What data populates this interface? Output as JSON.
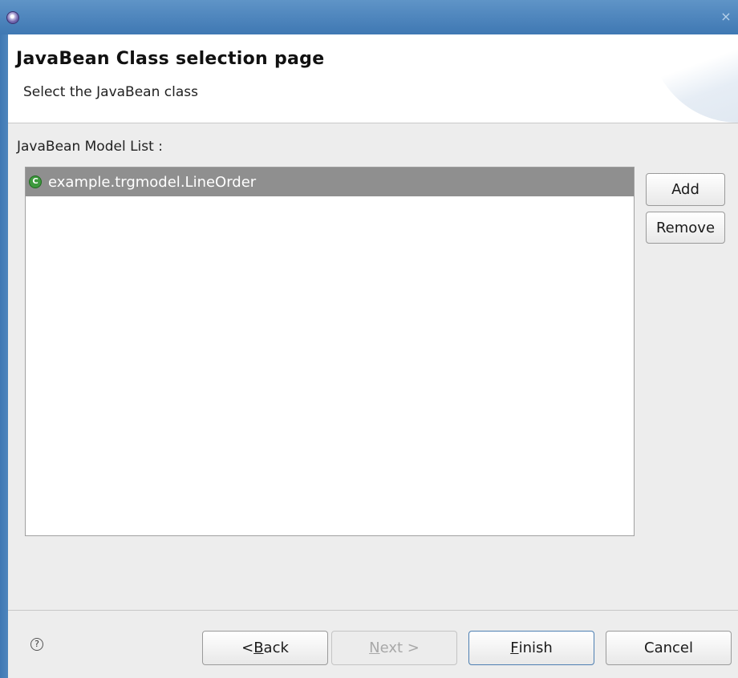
{
  "colors": {
    "titlebar": "#4a82bb",
    "selection": "#8f8f8f",
    "class_icon": "#3e9a3e"
  },
  "header": {
    "title": "JavaBean Class selection page",
    "subtitle": "Select the JavaBean class"
  },
  "list": {
    "label": "JavaBean Model List :",
    "items": [
      {
        "icon": "class-icon",
        "icon_glyph": "C",
        "label": "example.trgmodel.LineOrder",
        "selected": true
      }
    ]
  },
  "side_buttons": {
    "add": "Add",
    "remove": "Remove"
  },
  "footer": {
    "help_glyph": "?",
    "back": {
      "prefix": "< ",
      "mnemonic": "B",
      "rest": "ack"
    },
    "next": {
      "mnemonic": "N",
      "rest": "ext >",
      "enabled": false
    },
    "finish": {
      "mnemonic": "F",
      "rest": "inish"
    },
    "cancel": "Cancel"
  },
  "window": {
    "close_glyph": "×"
  }
}
